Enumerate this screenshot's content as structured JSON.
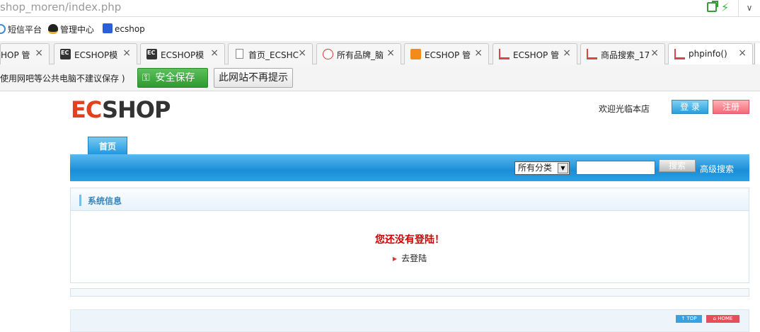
{
  "browser": {
    "url": "shop_moren/index.php",
    "bookmarks": [
      {
        "label": "短信平台"
      },
      {
        "label": "管理中心"
      },
      {
        "label": "ecshop"
      }
    ],
    "tabs": [
      {
        "label": "HOP 管"
      },
      {
        "label": "ECSHOP模"
      },
      {
        "label": "ECSHOP模"
      },
      {
        "label": "首页_ECSHC"
      },
      {
        "label": "所有品牌_脑"
      },
      {
        "label": "ECSHOP 管"
      },
      {
        "label": "ECSHOP 管"
      },
      {
        "label": "商品搜索_17"
      },
      {
        "label": "phpinfo()"
      }
    ],
    "tab_close": "×",
    "notification": {
      "text": "使用网吧等公共电脑不建议保存 )",
      "save_label": "安全保存",
      "never_label": "此网站不再提示"
    }
  },
  "site": {
    "logo_a": "EC",
    "logo_b": "SHOP",
    "welcome": "欢迎光临本店",
    "login_label": "登 录",
    "register_label": "注册",
    "nav_home": "首页",
    "search": {
      "category": "所有分类",
      "button": "搜索",
      "advanced": "高级搜索"
    },
    "system_box": {
      "title": "系统信息",
      "message": "您还没有登陆！",
      "link": "去登陆"
    },
    "footer": {
      "top": "↑ TOP",
      "home": "⌂ HOME"
    }
  },
  "colors": {
    "accent_blue": "#1a8ed8",
    "error_red": "#cc0000",
    "save_green": "#2f9a2f"
  }
}
